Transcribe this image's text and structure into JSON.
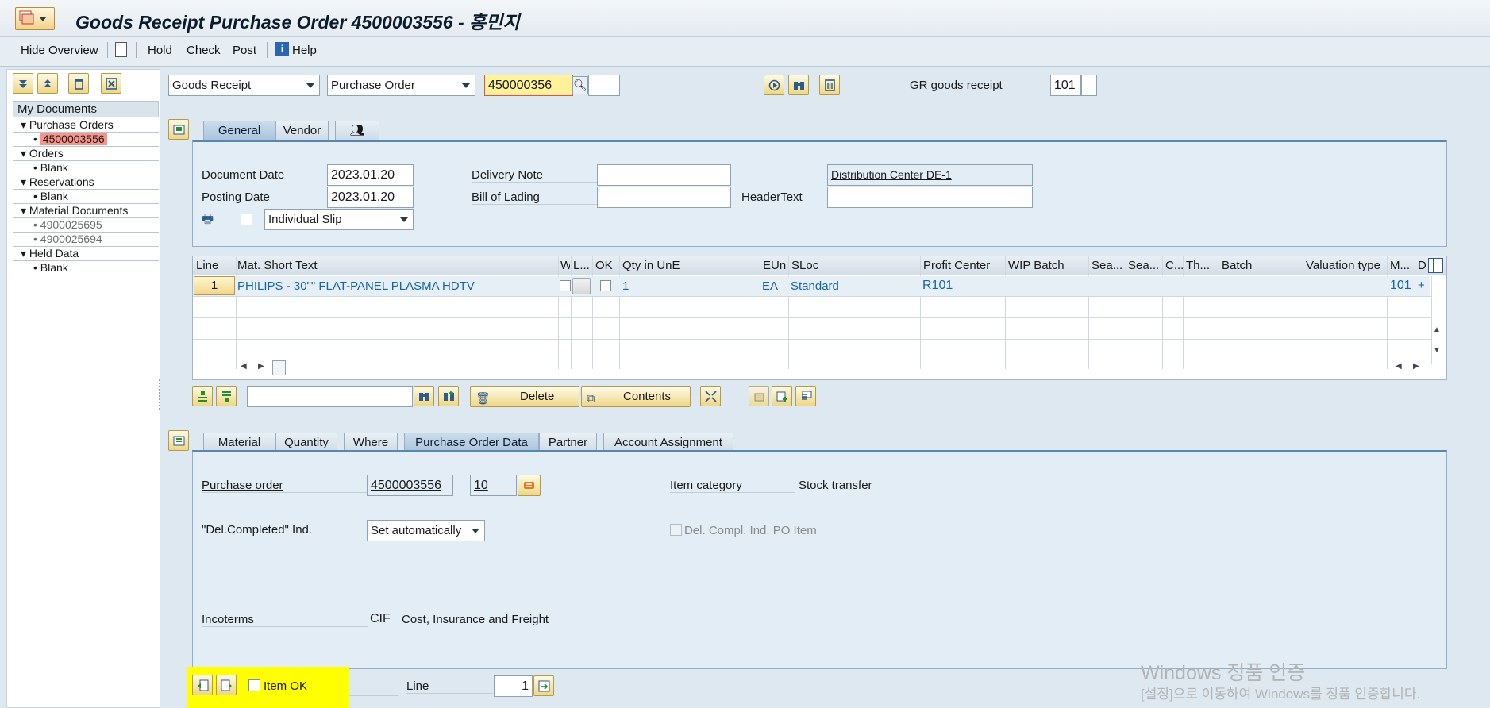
{
  "window": {
    "title": "Goods Receipt Purchase Order 4500003556 - 홍민지"
  },
  "menu": {
    "hide_overview": "Hide Overview",
    "hold": "Hold",
    "check": "Check",
    "post": "Post",
    "help": "Help"
  },
  "tree": {
    "header": "My Documents",
    "purchase_orders": "Purchase Orders",
    "po_item": "4500003556",
    "orders": "Orders",
    "orders_item": "Blank",
    "reservations": "Reservations",
    "reservations_item": "Blank",
    "material_documents": "Material Documents",
    "md_item1": "4900025695",
    "md_item2": "4900025694",
    "held_data": "Held Data",
    "held_item": "Blank"
  },
  "header_fields": {
    "transaction": "Goods Receipt",
    "reference": "Purchase Order",
    "po_number": "450000356",
    "gr_label": "GR goods receipt",
    "movement_type": "101"
  },
  "header_tabs": {
    "general": "General",
    "vendor": "Vendor"
  },
  "general": {
    "document_date_label": "Document Date",
    "document_date": "2023.01.20",
    "posting_date_label": "Posting Date",
    "posting_date": "2023.01.20",
    "slip_type": "Individual Slip",
    "delivery_note_label": "Delivery Note",
    "delivery_note": "",
    "bill_of_lading_label": "Bill of Lading",
    "bill_of_lading": "",
    "header_text_label": "HeaderText",
    "header_text": "",
    "vendor_name": "Distribution Center DE-1"
  },
  "grid": {
    "columns": [
      "Line",
      "Mat. Short Text",
      "W",
      "L...",
      "OK",
      "Qty in UnE",
      "EUn",
      "SLoc",
      "Profit Center",
      "WIP Batch",
      "Sea...",
      "Sea...",
      "C...",
      "Th...",
      "Batch",
      "Valuation type",
      "M...",
      "D"
    ],
    "rows": [
      {
        "line": "1",
        "material": "PHILIPS - 30\"\" FLAT-PANEL PLASMA HDTV",
        "qty": "1",
        "eun": "EA",
        "sloc": "Standard",
        "profit_center": "R101",
        "movement": "101",
        "d": "+"
      }
    ]
  },
  "grid_toolbar": {
    "delete": "Delete",
    "contents": "Contents",
    "search": ""
  },
  "detail_tabs": {
    "material": "Material",
    "quantity": "Quantity",
    "where": "Where",
    "po_data": "Purchase Order Data",
    "partner": "Partner",
    "account_assignment": "Account Assignment"
  },
  "detail": {
    "purchase_order_label": "Purchase order",
    "purchase_order": "4500003556",
    "po_item": "10",
    "item_category_label": "Item category",
    "item_category": "Stock transfer",
    "del_completed_label": "\"Del.Completed\" Ind.",
    "del_completed": "Set automatically",
    "del_compl_po_item": "Del. Compl. Ind. PO Item",
    "incoterms_label": "Incoterms",
    "incoterms_code": "CIF",
    "incoterms_text": "Cost, Insurance and Freight"
  },
  "footer": {
    "item_ok": "Item OK",
    "line_label": "Line",
    "line_value": "1"
  },
  "watermark": {
    "line1": "Windows 정품 인증",
    "line2": "[설정]으로 이동하여 Windows를 정품 인증합니다."
  }
}
